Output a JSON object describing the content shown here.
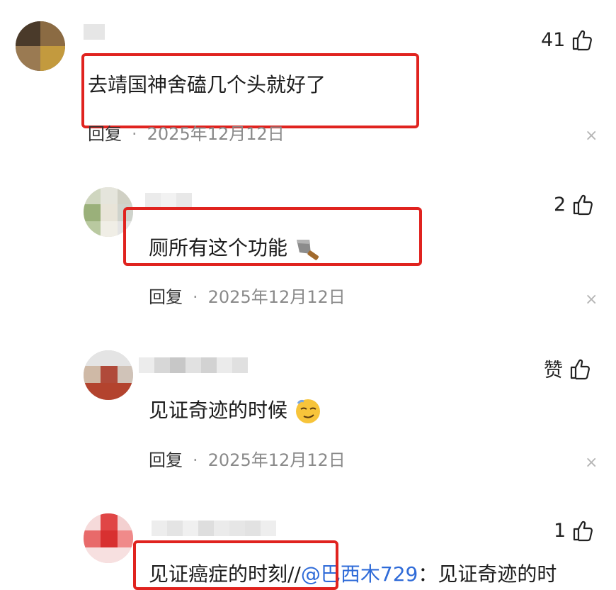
{
  "comments": [
    {
      "text": "去靖国神舍磕几个头就好了",
      "reply_label": "回复",
      "separator": "·",
      "date": "2025年12月12日",
      "likes": "41",
      "close_glyph": "×"
    },
    {
      "text": "厕所有这个功能",
      "reply_label": "回复",
      "separator": "·",
      "date": "2025年12月12日",
      "likes": "2",
      "close_glyph": "×"
    },
    {
      "text": "见证奇迹的时候",
      "reply_label": "回复",
      "separator": "·",
      "date": "2025年12月12日",
      "likes": "赞",
      "close_glyph": "×"
    },
    {
      "text_prefix": "见证癌症的时刻//",
      "mention": "@巴西木729",
      "text_suffix": "：见证奇迹的时",
      "likes": "1"
    }
  ],
  "colors": {
    "highlight": "#e0231f",
    "mention": "#2f6bd8",
    "meta": "#8a8a8a"
  },
  "icons": [
    "thumbs-up-icon",
    "close-icon",
    "knife-emoji",
    "smirk-emoji"
  ]
}
